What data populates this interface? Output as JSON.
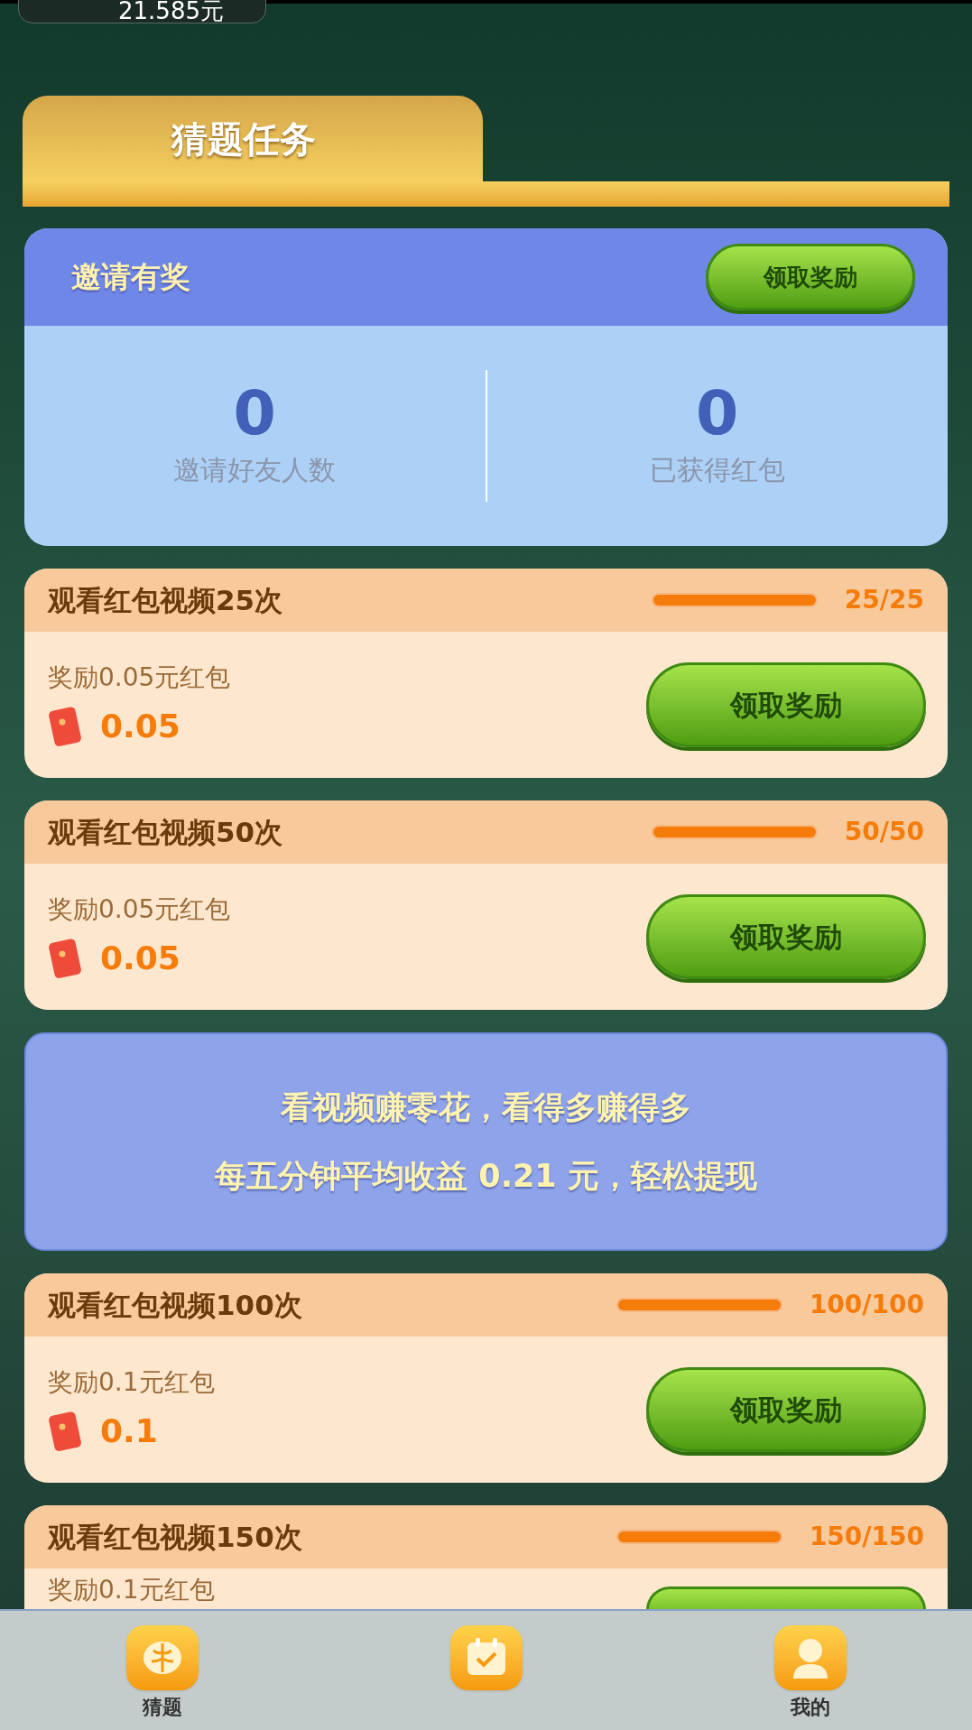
{
  "balance": "21.585元",
  "section_tab": "猜题任务",
  "invite": {
    "title": "邀请有奖",
    "button": "领取奖励",
    "stats": [
      {
        "value": "0",
        "label": "邀请好友人数"
      },
      {
        "value": "0",
        "label": "已获得红包"
      }
    ]
  },
  "tasks": [
    {
      "kind": "task",
      "title": "观看红包视频25次",
      "level": 1,
      "progress": "25/25",
      "reward": "奖励0.05元红包",
      "amount": "0.05",
      "button": "领取奖励"
    },
    {
      "kind": "task",
      "title": "观看红包视频50次",
      "level": 1,
      "progress": "50/50",
      "reward": "奖励0.05元红包",
      "amount": "0.05",
      "button": "领取奖励"
    },
    {
      "kind": "banner",
      "lines": [
        "看视频赚零花，看得多赚得多",
        "每五分钟平均收益 0.21 元，轻松提现"
      ]
    },
    {
      "kind": "task",
      "title": "观看红包视频100次",
      "level": 1,
      "progress": "100/100",
      "reward": "奖励0.1元红包",
      "amount": "0.1",
      "button": "领取奖励"
    },
    {
      "kind": "task",
      "title": "观看红包视频150次",
      "level": 1,
      "progress": "150/150",
      "reward": "奖励0.1元红包"
    }
  ],
  "nav": [
    {
      "label": "猜题",
      "selected": false
    },
    {
      "label": "我的",
      "selected": false
    }
  ]
}
